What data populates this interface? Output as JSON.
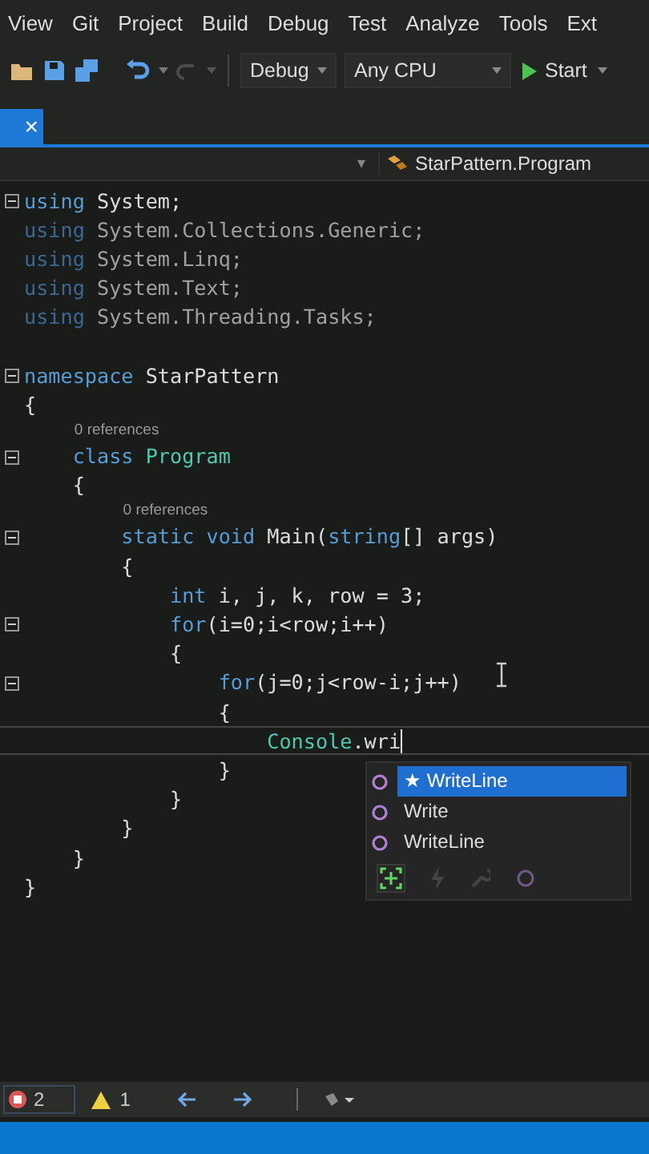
{
  "menu": [
    "View",
    "Git",
    "Project",
    "Build",
    "Debug",
    "Test",
    "Analyze",
    "Tools",
    "Ext"
  ],
  "toolbar": {
    "configuration": "Debug",
    "platform": "Any CPU",
    "start": "Start",
    "redo_disabled": true
  },
  "tab": {
    "close": "×"
  },
  "nav": {
    "caret": "▾",
    "member": "StarPattern.Program"
  },
  "code": [
    {
      "kind": "code",
      "fold": true,
      "tokens": [
        {
          "t": "using",
          "kind": "kw"
        },
        {
          "t": " System;",
          "kind": "plain"
        }
      ]
    },
    {
      "kind": "code",
      "fold": false,
      "tokens": [
        {
          "t": "using",
          "kind": "kwdim"
        },
        {
          "t": " System.Collections.Generic;",
          "kind": "dim"
        }
      ]
    },
    {
      "kind": "code",
      "fold": false,
      "tokens": [
        {
          "t": "using",
          "kind": "kwdim"
        },
        {
          "t": " System.Linq;",
          "kind": "dim"
        }
      ]
    },
    {
      "kind": "code",
      "fold": false,
      "tokens": [
        {
          "t": "using",
          "kind": "kwdim"
        },
        {
          "t": " System.Text;",
          "kind": "dim"
        }
      ]
    },
    {
      "kind": "code",
      "fold": false,
      "tokens": [
        {
          "t": "using",
          "kind": "kwdim"
        },
        {
          "t": " System.Threading.Tasks;",
          "kind": "dim"
        }
      ]
    },
    {
      "kind": "blank"
    },
    {
      "kind": "code",
      "fold": true,
      "tokens": [
        {
          "t": "namespace",
          "kind": "kw"
        },
        {
          "t": " StarPattern",
          "kind": "plain"
        }
      ]
    },
    {
      "kind": "code",
      "fold": false,
      "tokens": [
        {
          "t": "{",
          "kind": "plain"
        }
      ]
    },
    {
      "kind": "lens",
      "text": "0 references"
    },
    {
      "kind": "code",
      "fold": true,
      "tokens": [
        {
          "t": "    class ",
          "kind": "kw"
        },
        {
          "t": "Program",
          "kind": "type"
        }
      ]
    },
    {
      "kind": "code",
      "fold": false,
      "tokens": [
        {
          "t": "    {",
          "kind": "plain"
        }
      ]
    },
    {
      "kind": "lens",
      "text": "0 references"
    },
    {
      "kind": "code",
      "fold": true,
      "tokens": [
        {
          "t": "        static void",
          "kind": "kw"
        },
        {
          "t": " Main(",
          "kind": "plain"
        },
        {
          "t": "string",
          "kind": "kw"
        },
        {
          "t": "[] args)",
          "kind": "plain"
        }
      ]
    },
    {
      "kind": "code",
      "fold": false,
      "tokens": [
        {
          "t": "        {",
          "kind": "plain"
        }
      ]
    },
    {
      "kind": "code",
      "fold": false,
      "tokens": [
        {
          "t": "            int",
          "kind": "kw"
        },
        {
          "t": " i, j, k, row = 3;",
          "kind": "plain"
        }
      ]
    },
    {
      "kind": "code",
      "fold": true,
      "tokens": [
        {
          "t": "            for",
          "kind": "kw"
        },
        {
          "t": "(i=0;i<row;i++)",
          "kind": "plain"
        }
      ]
    },
    {
      "kind": "code",
      "fold": false,
      "tokens": [
        {
          "t": "            {",
          "kind": "plain"
        }
      ]
    },
    {
      "kind": "code",
      "fold": true,
      "tokens": [
        {
          "t": "                for",
          "kind": "kw"
        },
        {
          "t": "(j=0;j<row-i;j++)",
          "kind": "plain"
        }
      ]
    },
    {
      "kind": "code",
      "fold": false,
      "tokens": [
        {
          "t": "                {",
          "kind": "plain"
        }
      ]
    },
    {
      "kind": "code",
      "fold": false,
      "current": true,
      "tokens": [
        {
          "t": "                    Console",
          "kind": "type"
        },
        {
          "t": ".wri",
          "kind": "plain"
        }
      ]
    },
    {
      "kind": "code",
      "fold": false,
      "tokens": [
        {
          "t": "                }",
          "kind": "plain"
        }
      ]
    },
    {
      "kind": "code",
      "fold": false,
      "tokens": [
        {
          "t": "            }",
          "kind": "plain"
        }
      ]
    },
    {
      "kind": "code",
      "fold": false,
      "tokens": [
        {
          "t": "        }",
          "kind": "plain"
        }
      ]
    },
    {
      "kind": "code",
      "fold": false,
      "tokens": [
        {
          "t": "    }",
          "kind": "plain"
        }
      ]
    },
    {
      "kind": "code",
      "fold": false,
      "tokens": [
        {
          "t": "}",
          "kind": "plain"
        }
      ]
    }
  ],
  "completion": {
    "items": [
      {
        "label": "★ WriteLine",
        "selected": true
      },
      {
        "label": "Write",
        "selected": false
      },
      {
        "label": "WriteLine",
        "selected": false
      }
    ],
    "filters": [
      {
        "kind": "add",
        "active": true
      },
      {
        "kind": "bolt",
        "active": false
      },
      {
        "kind": "wrench",
        "active": false
      },
      {
        "kind": "method",
        "active": false
      }
    ]
  },
  "status": {
    "errors": "2",
    "warnings": "1"
  }
}
